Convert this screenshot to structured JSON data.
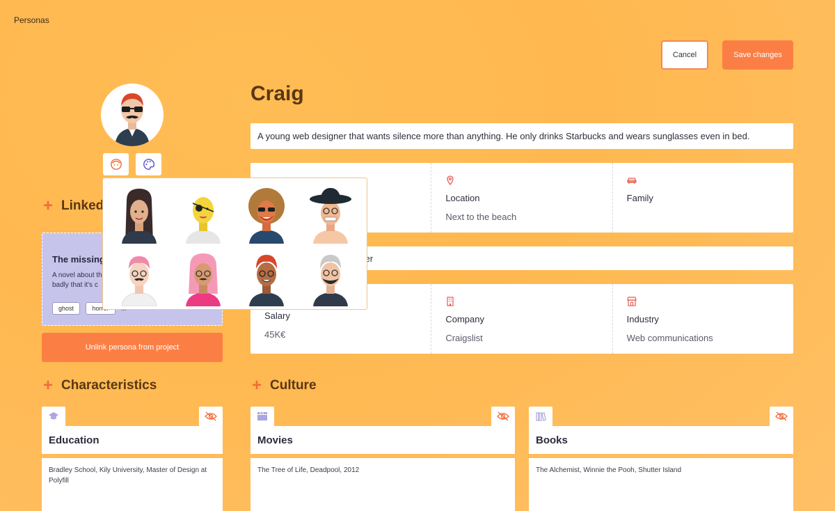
{
  "breadcrumb": "Personas",
  "actions": {
    "cancel": "Cancel",
    "save": "Save changes"
  },
  "persona": {
    "name": "Craig",
    "description": "A young web designer that wants silence more than anything. He only drinks Starbucks and wears sunglasses even in bed.",
    "location_label": "Location",
    "location_value": "Next to the beach",
    "family_label": "Family",
    "job_partial": "gner",
    "salary_label": "Salary",
    "salary_value": "45K€",
    "company_label": "Company",
    "company_value": "Craigslist",
    "industry_label": "Industry",
    "industry_value": "Web communications"
  },
  "linked": {
    "title_partial": "Linked",
    "card_title": "The missing",
    "card_desc_1": "A novel about th",
    "card_desc_2": "badly that it's c",
    "tags": [
      "ghost",
      "horror",
      "..."
    ],
    "unlink": "Unlink persona from project"
  },
  "sections": {
    "characteristics": "Characteristics",
    "culture": "Culture"
  },
  "traits": {
    "education": {
      "title": "Education",
      "text": "Bradley School, Kily University, Master of Design at Polyfill"
    },
    "movies": {
      "title": "Movies",
      "text": "The Tree of Life, Deadpool, 2012"
    },
    "books": {
      "title": "Books",
      "text": "The Alchemist, Winnie the Pooh, Shutter Island"
    }
  },
  "colors": {
    "accent": "#fb7f45",
    "title": "#5a3712",
    "icon": "#a9a6e0"
  }
}
